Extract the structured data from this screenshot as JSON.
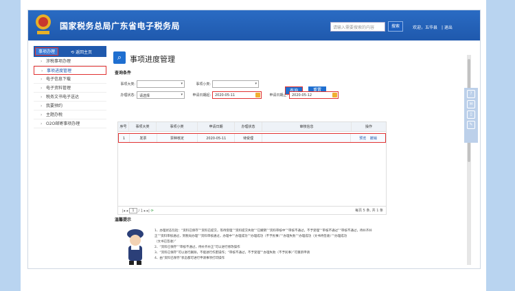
{
  "header": {
    "title": "国家税务总局广东省电子税务局",
    "search_placeholder": "请输入需要搜索的内容",
    "search_button": "搜索",
    "welcome": "欢迎，五华县",
    "logout": "| 退出"
  },
  "sidebar": {
    "tab_active": "事项办理",
    "tab_home": "返回主页",
    "items": [
      {
        "label": "涉税事项办理"
      },
      {
        "label": "事项进度管理"
      },
      {
        "label": "电子信息下载"
      },
      {
        "label": "电子资料管理"
      },
      {
        "label": "税务文书电子送达"
      },
      {
        "label": "我要预约"
      },
      {
        "label": "主题办税"
      },
      {
        "label": "O2O邮寄事项办理"
      }
    ]
  },
  "main": {
    "page_title": "事项进度管理",
    "section_label": "查询条件",
    "filters": {
      "category_label": "事项大类:",
      "subcategory_label": "事项小类:",
      "status_label": "办理状态:",
      "status_value": "请选择",
      "start_date_label": "申请日期起:",
      "start_date_value": "2020-05-11",
      "end_date_label": "申请日期止:",
      "end_date_value": "2020-05-12"
    },
    "buttons": {
      "query": "查询",
      "reset": "重置"
    },
    "table": {
      "columns": [
        "序号",
        "事项大类",
        "事项小类",
        "申请日期",
        "办理状态",
        "审核信息",
        "操作"
      ],
      "rows": [
        {
          "no": "1",
          "category": "发票",
          "subcategory": "票种核定",
          "date": "2020-05-11",
          "status": "待受理",
          "review": "",
          "op_view": "预览",
          "op_cancel": "撤销"
        }
      ]
    },
    "pager": {
      "page_input": "1",
      "total_pages": "/ 1",
      "summary": "每页 5 条, 共 1 条"
    },
    "tips": {
      "title": "温馨提示",
      "lines": [
        "1、办理状态包括：“资料已保存”“资料已提交，等待受理”“资料提交失败”“已撤销”“资料审核中”“审核不通过，不予受理”“审核不通过”“审核不通过，待补齐补",
        "正”“资料审核通过，到税局办理”“资料审核通过，办理中”“办理成功”“办理成功（不予民事）”“办理失败”“办理成功（文书待签收）”“办理成功",
        "（文书已签收）”",
        "2、“资料已保存”“审核不通过，待补齐补正”可以进行修改操作",
        "3、“资料已保存”可以进行删除，不能进行作废操作；“审核不通过，不予受理”“办理失败（不予民事）”可重新申请",
        "4、由“资料已保存”状态都可进行申请事项打印操作"
      ]
    }
  }
}
